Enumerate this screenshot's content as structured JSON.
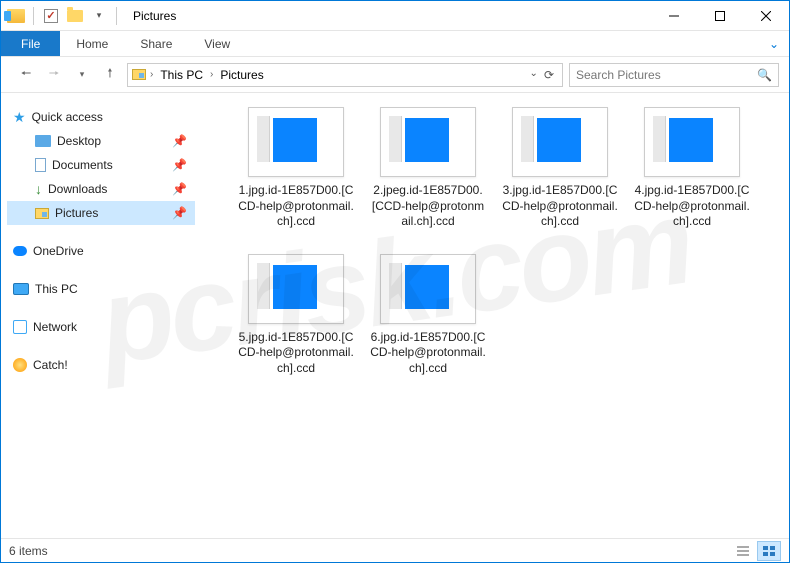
{
  "title": "Pictures",
  "ribbon": {
    "file": "File",
    "tabs": [
      "Home",
      "Share",
      "View"
    ]
  },
  "nav": {
    "crumbs": [
      "This PC",
      "Pictures"
    ],
    "search_placeholder": "Search Pictures"
  },
  "sidebar": {
    "quick": "Quick access",
    "quick_children": [
      "Desktop",
      "Documents",
      "Downloads",
      "Pictures"
    ],
    "onedrive": "OneDrive",
    "thispc": "This PC",
    "network": "Network",
    "catch": "Catch!"
  },
  "files": [
    "1.jpg.id-1E857D00.[CCD-help@protonmail.ch].ccd",
    "2.jpeg.id-1E857D00.[CCD-help@protonmail.ch].ccd",
    "3.jpg.id-1E857D00.[CCD-help@protonmail.ch].ccd",
    "4.jpg.id-1E857D00.[CCD-help@protonmail.ch].ccd",
    "5.jpg.id-1E857D00.[CCD-help@protonmail.ch].ccd",
    "6.jpg.id-1E857D00.[CCD-help@protonmail.ch].ccd"
  ],
  "status": "6 items",
  "watermark": "pcrisk.com"
}
